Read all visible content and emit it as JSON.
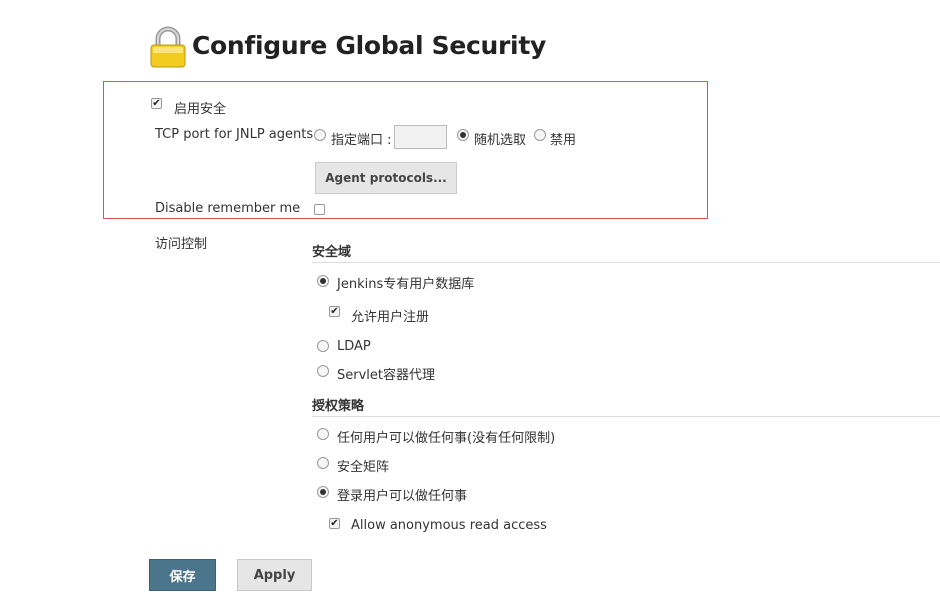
{
  "page": {
    "title": "Configure Global Security",
    "lock_icon": "lock-icon"
  },
  "security": {
    "enable_label": "启用安全",
    "enable_checked": true,
    "tcp_label": "TCP port for JNLP agents",
    "tcp_options": [
      {
        "label": "指定端口 :",
        "selected": false
      },
      {
        "label": "随机选取",
        "selected": true
      },
      {
        "label": "禁用",
        "selected": false
      }
    ],
    "port_value": "",
    "agent_protocols_label": "Agent protocols...",
    "disable_remember_label": "Disable remember me",
    "disable_remember_checked": false
  },
  "access_control": {
    "label": "访问控制",
    "realm_heading": "安全域",
    "realm_options": [
      {
        "label": "Jenkins专有用户数据库",
        "selected": true
      },
      {
        "label": "LDAP",
        "selected": false
      },
      {
        "label": "Servlet容器代理",
        "selected": false
      }
    ],
    "allow_signup_label": "允许用户注册",
    "allow_signup_checked": true,
    "authz_heading": "授权策略",
    "authz_options": [
      {
        "label": "任何用户可以做任何事(没有任何限制)",
        "selected": false
      },
      {
        "label": "安全矩阵",
        "selected": false
      },
      {
        "label": "登录用户可以做任何事",
        "selected": true
      }
    ],
    "anon_read_label": "Allow anonymous read access",
    "anon_read_checked": true
  },
  "buttons": {
    "save": "保存",
    "apply": "Apply"
  },
  "colors": {
    "save_bg": "#4b758b",
    "highlight_border": "#d9534f"
  }
}
